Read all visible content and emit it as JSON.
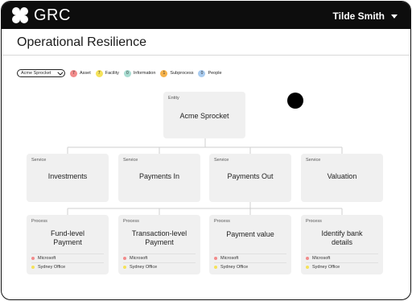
{
  "app": {
    "logo_text": "GRC",
    "user_name": "Tilde Smith"
  },
  "page": {
    "title": "Operational Resilience"
  },
  "filter": {
    "selected": "Acme Sprocket"
  },
  "legend": [
    {
      "count": "7",
      "label": "Asset",
      "color": "#f28b8b"
    },
    {
      "count": "7",
      "label": "Facility",
      "color": "#f5e25a"
    },
    {
      "count": "0",
      "label": "Information",
      "color": "#a8ddd2"
    },
    {
      "count": "1",
      "label": "Subprocess",
      "color": "#f6b24b"
    },
    {
      "count": "0",
      "label": "People",
      "color": "#a9ccf0"
    }
  ],
  "entity": {
    "kind": "Entity",
    "title": "Acme Sprocket"
  },
  "services": [
    {
      "kind": "Service",
      "title": "Investments"
    },
    {
      "kind": "Service",
      "title": "Payments In"
    },
    {
      "kind": "Service",
      "title": "Payments Out"
    },
    {
      "kind": "Service",
      "title": "Valuation"
    }
  ],
  "processes": [
    {
      "kind": "Process",
      "title_line1": "Fund-level",
      "title_line2": "Payment",
      "assets": [
        "Microsoft",
        "Sydney Office"
      ]
    },
    {
      "kind": "Process",
      "title_line1": "Transaction-level",
      "title_line2": "Payment",
      "assets": [
        "Microsoft",
        "Sydney Office"
      ]
    },
    {
      "kind": "Process",
      "title_line1": "Payment value",
      "title_line2": "",
      "assets": [
        "Microsoft",
        "Sydney Office"
      ]
    },
    {
      "kind": "Process",
      "title_line1": "Identify bank",
      "title_line2": "details",
      "assets": [
        "Microsoft",
        "Sydney Office"
      ]
    }
  ],
  "asset_colors": [
    "#f28b8b",
    "#f5e25a"
  ]
}
